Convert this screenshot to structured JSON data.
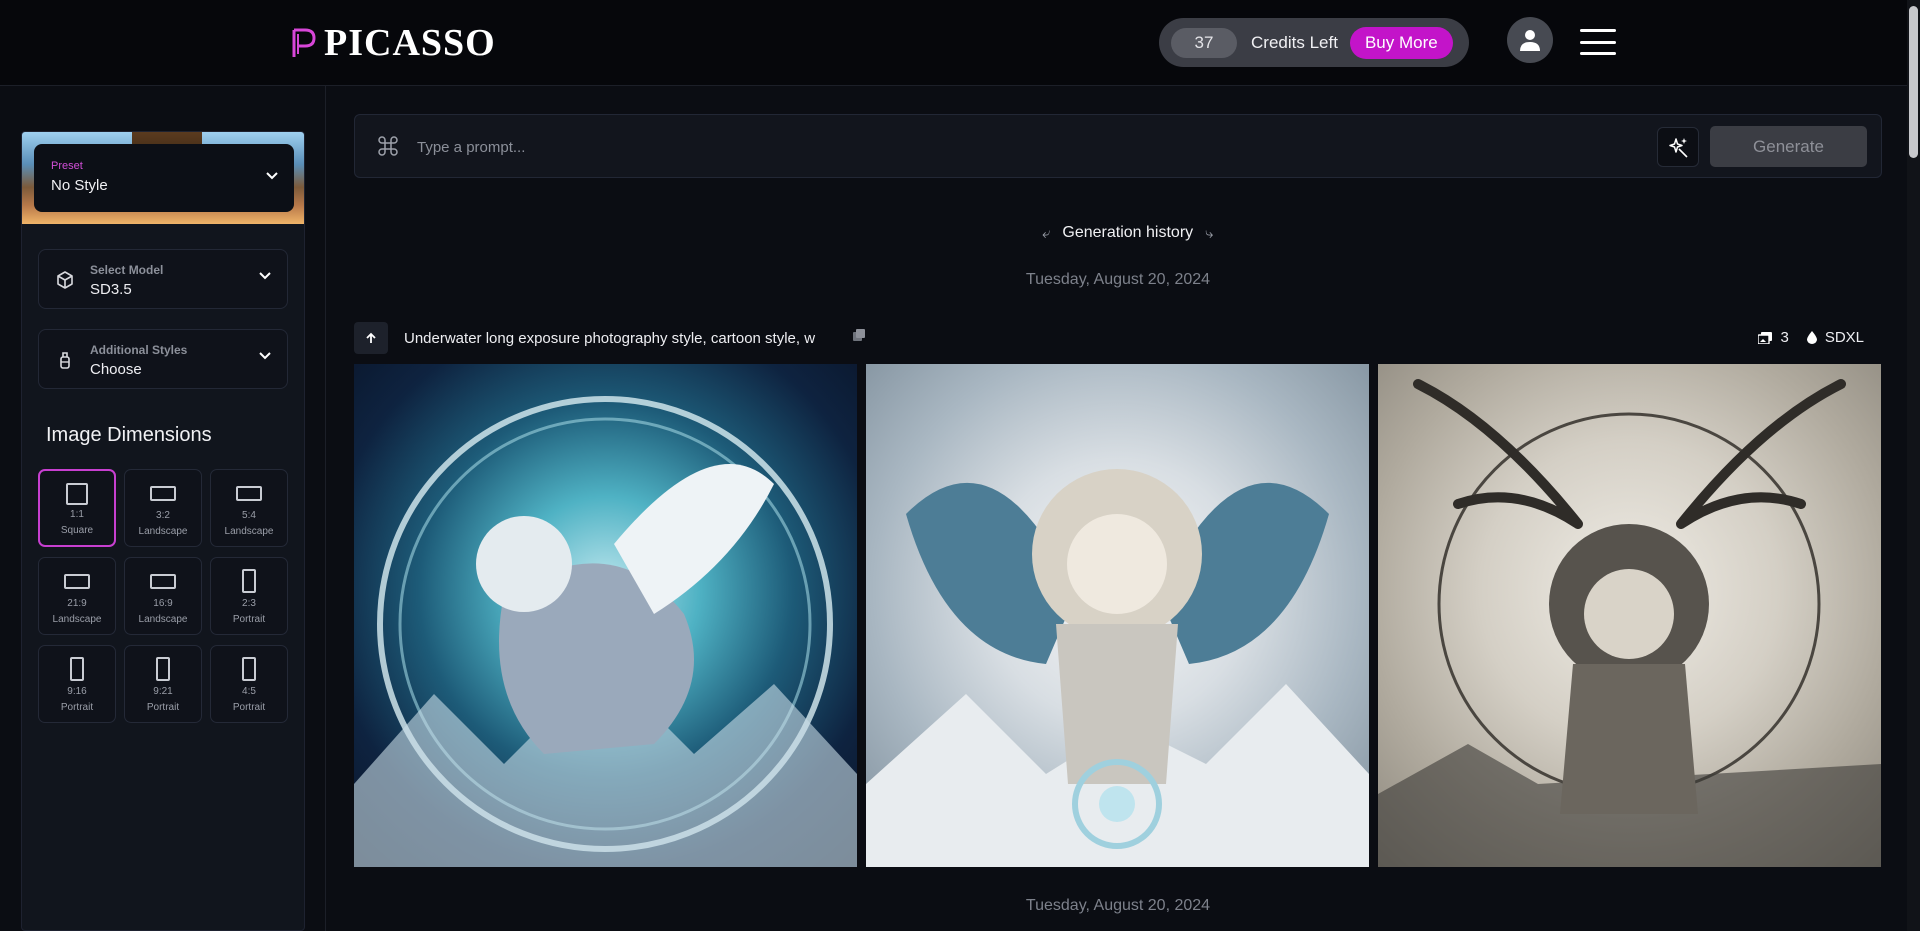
{
  "app": {
    "name": "PICASSO"
  },
  "header": {
    "credits_count": "37",
    "credits_label": "Credits Left",
    "buy_more_label": "Buy More"
  },
  "sidebar": {
    "preset": {
      "caption": "Preset",
      "value": "No Style"
    },
    "model": {
      "caption": "Select Model",
      "value": "SD3.5"
    },
    "additional_styles": {
      "caption": "Additional Styles",
      "value": "Choose"
    },
    "dimensions_title": "Image Dimensions",
    "dimensions": [
      {
        "ratio": "1:1",
        "kind": "Square",
        "selected": true
      },
      {
        "ratio": "3:2",
        "kind": "Landscape",
        "selected": false
      },
      {
        "ratio": "5:4",
        "kind": "Landscape",
        "selected": false
      },
      {
        "ratio": "21:9",
        "kind": "Landscape",
        "selected": false
      },
      {
        "ratio": "16:9",
        "kind": "Landscape",
        "selected": false
      },
      {
        "ratio": "2:3",
        "kind": "Portrait",
        "selected": false
      },
      {
        "ratio": "9:16",
        "kind": "Portrait",
        "selected": false
      },
      {
        "ratio": "9:21",
        "kind": "Portrait",
        "selected": false
      },
      {
        "ratio": "4:5",
        "kind": "Portrait",
        "selected": false
      }
    ]
  },
  "prompt": {
    "placeholder": "Type a prompt...",
    "generate_label": "Generate"
  },
  "history": {
    "title": "Generation history",
    "groups": [
      {
        "date": "Tuesday, August 20, 2024",
        "prompt": "Underwater long exposure photography style, cartoon style, w",
        "image_count": "3",
        "model": "SDXL"
      },
      {
        "date": "Tuesday, August 20, 2024"
      }
    ]
  },
  "colors": {
    "accent": "#c314c9",
    "background": "#0b0d13",
    "topbar": "#06070b"
  }
}
